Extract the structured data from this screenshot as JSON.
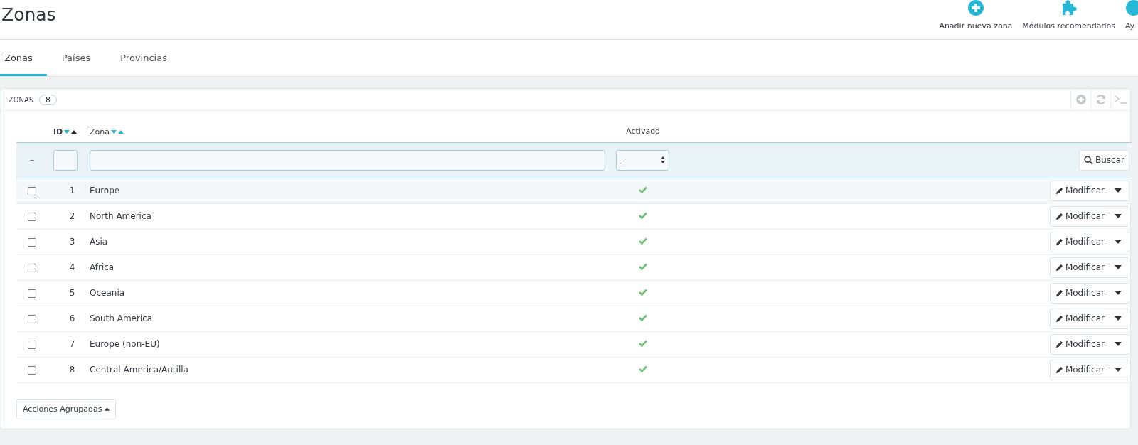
{
  "page": {
    "title": "Zonas"
  },
  "toolbar": [
    {
      "kind": "add",
      "label": "Añadir nueva zona"
    },
    {
      "kind": "modules",
      "label": "Módulos recomendados"
    },
    {
      "kind": "help",
      "label": "Ay"
    }
  ],
  "tabs": [
    {
      "label": "Zonas",
      "selected": true
    },
    {
      "label": "Países",
      "selected": false
    },
    {
      "label": "Provincias",
      "selected": false
    }
  ],
  "panel": {
    "title": "ZONAS",
    "count": "8"
  },
  "table": {
    "columns": [
      {
        "label": "ID",
        "sorted_asc": true
      },
      {
        "label": "Zona",
        "sorted_asc": false
      },
      {
        "label": "Activado"
      }
    ],
    "filter": {
      "reset": "–",
      "select_value": "-",
      "search_button": "Buscar"
    },
    "rows": [
      {
        "id": "1",
        "zone": "Europe",
        "enabled": true,
        "hovered": true,
        "checked": false,
        "action": "Modificar"
      },
      {
        "id": "2",
        "zone": "North America",
        "enabled": true,
        "hovered": false,
        "checked": false,
        "action": "Modificar"
      },
      {
        "id": "3",
        "zone": "Asia",
        "enabled": true,
        "hovered": false,
        "checked": false,
        "action": "Modificar"
      },
      {
        "id": "4",
        "zone": "Africa",
        "enabled": true,
        "hovered": false,
        "checked": false,
        "action": "Modificar"
      },
      {
        "id": "5",
        "zone": "Oceania",
        "enabled": true,
        "hovered": false,
        "checked": false,
        "action": "Modificar"
      },
      {
        "id": "6",
        "zone": "South America",
        "enabled": true,
        "hovered": false,
        "checked": false,
        "action": "Modificar"
      },
      {
        "id": "7",
        "zone": "Europe (non-EU)",
        "enabled": true,
        "hovered": false,
        "checked": false,
        "action": "Modificar"
      },
      {
        "id": "8",
        "zone": "Central America/Antilla",
        "enabled": true,
        "hovered": false,
        "checked": false,
        "action": "Modificar"
      }
    ]
  },
  "bulk_actions": {
    "label": "Acciones Agrupadas"
  }
}
